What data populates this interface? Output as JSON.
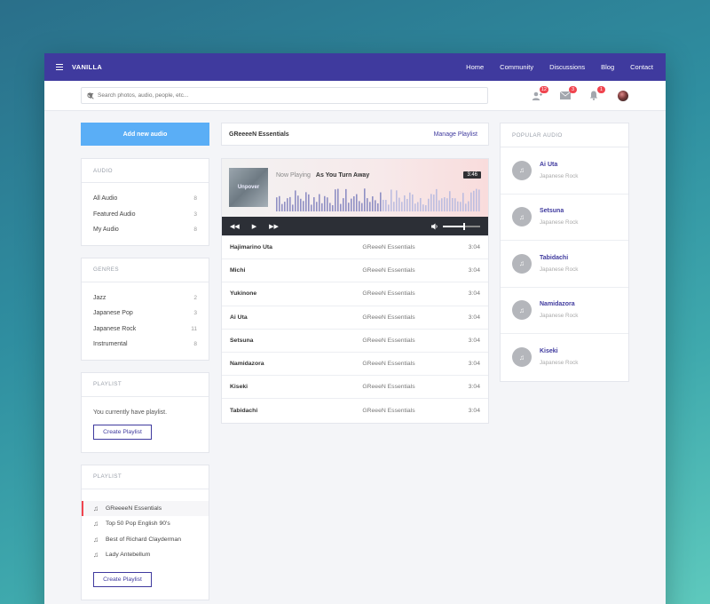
{
  "nav": {
    "brand": "VANILLA",
    "links": [
      "Home",
      "Community",
      "Discussions",
      "Blog",
      "Contact"
    ]
  },
  "search": {
    "placeholder": "Search photos, audio, people, etc...",
    "badges": {
      "friends": "12",
      "messages": "3",
      "notifications": "1"
    }
  },
  "left": {
    "add_button": "Add new audio",
    "audio": {
      "title": "AUDIO",
      "items": [
        {
          "label": "All Audio",
          "count": "8"
        },
        {
          "label": "Featured Audio",
          "count": "3"
        },
        {
          "label": "My Audio",
          "count": "8"
        }
      ]
    },
    "genres": {
      "title": "GENRES",
      "items": [
        {
          "label": "Jazz",
          "count": "2"
        },
        {
          "label": "Japanese Pop",
          "count": "3"
        },
        {
          "label": "Japanese Rock",
          "count": "11"
        },
        {
          "label": "Instrumental",
          "count": "8"
        }
      ]
    },
    "playlist_empty": {
      "title": "PLAYLIST",
      "text": "You currently have playlist.",
      "button": "Create Playlist"
    },
    "playlist": {
      "title": "PLAYLIST",
      "items": [
        "GReeeeN Essentials",
        "Top 50 Pop English 90's",
        "Best of Richard Clayderman",
        "Lady Antebellum"
      ],
      "button": "Create Playlist"
    }
  },
  "middle": {
    "title": "GReeeeN Essentials",
    "manage": "Manage Playlist",
    "player": {
      "cover_text": "Unpover",
      "now_label": "Now Playing",
      "song": "As You Turn Away",
      "duration": "3:46",
      "volume": 0.55
    },
    "tracks": [
      {
        "name": "Hajimarino Uta",
        "artist": "GReeeN Essentials",
        "time": "3:04"
      },
      {
        "name": "Michi",
        "artist": "GReeeN Essentials",
        "time": "3:04"
      },
      {
        "name": "Yukinone",
        "artist": "GReeeN Essentials",
        "time": "3:04"
      },
      {
        "name": "Ai Uta",
        "artist": "GReeeN Essentials",
        "time": "3:04"
      },
      {
        "name": "Setsuna",
        "artist": "GReeeN Essentials",
        "time": "3:04"
      },
      {
        "name": "Namidazora",
        "artist": "GReeeN Essentials",
        "time": "3:04"
      },
      {
        "name": "Kiseki",
        "artist": "GReeeN Essentials",
        "time": "3:04"
      },
      {
        "name": "Tabidachi",
        "artist": "GReeeN Essentials",
        "time": "3:04"
      }
    ]
  },
  "right": {
    "title": "POPULAR AUDIO",
    "items": [
      {
        "name": "Ai Uta",
        "genre": "Japanese Rock"
      },
      {
        "name": "Setsuna",
        "genre": "Japanese Rock"
      },
      {
        "name": "Tabidachi",
        "genre": "Japanese Rock"
      },
      {
        "name": "Namidazora",
        "genre": "Japanese Rock"
      },
      {
        "name": "Kiseki",
        "genre": "Japanese Rock"
      }
    ]
  },
  "colors": {
    "primary": "#3f3a9e",
    "accent": "#5aaef6",
    "badge": "#f0454f"
  }
}
